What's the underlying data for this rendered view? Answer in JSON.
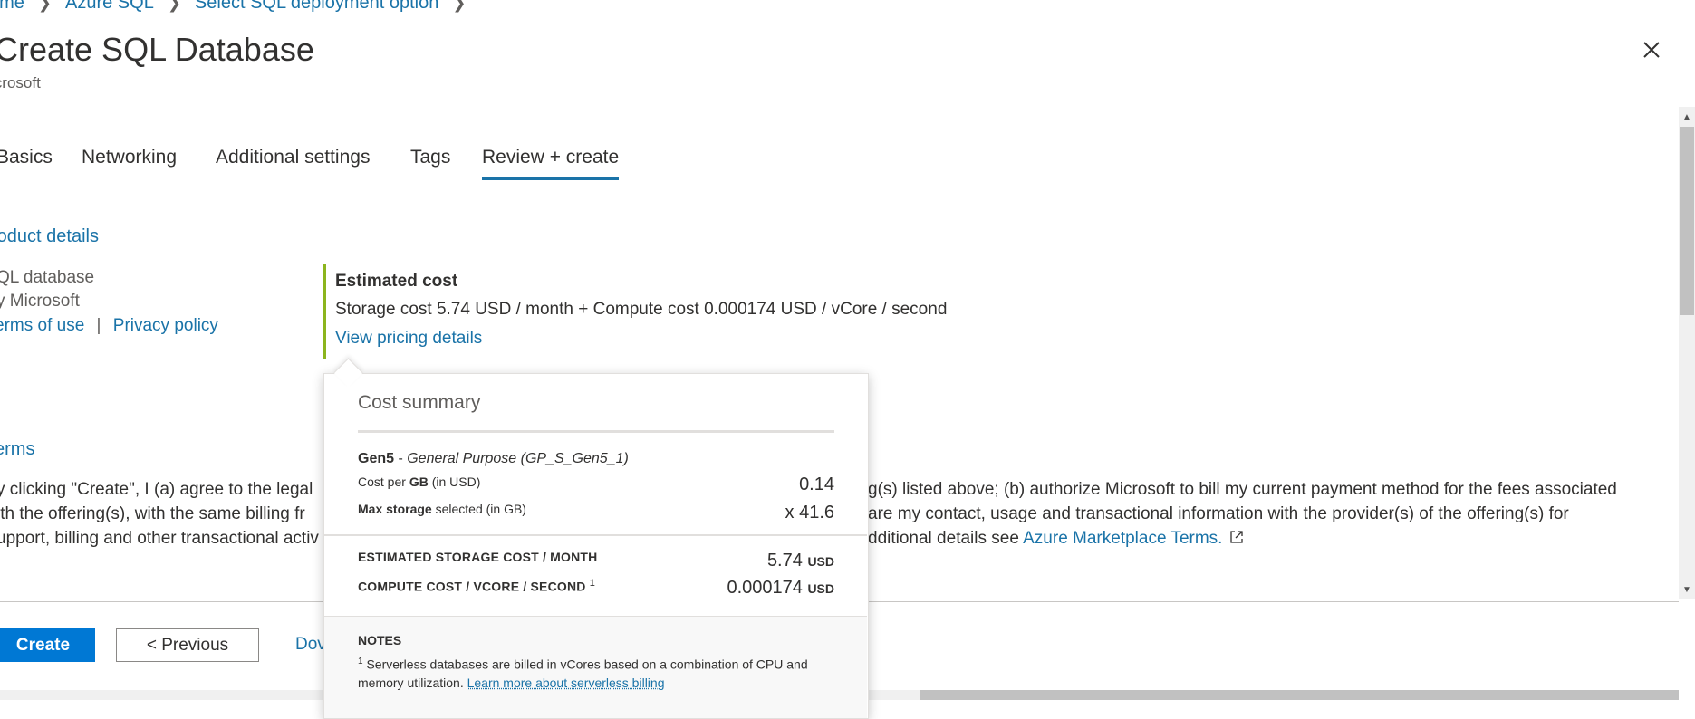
{
  "breadcrumb": {
    "items": [
      "ome",
      "Azure SQL",
      "Select SQL deployment option"
    ]
  },
  "header": {
    "title": "Create SQL Database",
    "publisher": "icrosoft"
  },
  "tabs": [
    {
      "label": "Basics"
    },
    {
      "label": "Networking"
    },
    {
      "label": "Additional settings"
    },
    {
      "label": "Tags"
    },
    {
      "label": "Review + create",
      "active": true
    }
  ],
  "product_details": {
    "heading": "roduct details",
    "name": "QL database",
    "by": "y Microsoft",
    "terms_link": "erms of use",
    "divider": "|",
    "privacy_link": "Privacy policy"
  },
  "estimated_cost": {
    "title": "Estimated cost",
    "line": "Storage cost 5.74 USD / month + Compute cost 0.000174 USD / vCore / second",
    "link": "View pricing details"
  },
  "terms": {
    "heading": "erms",
    "line1_left": "y clicking \"Create\", I (a) agree to the legal",
    "line1_right": "g(s) listed above; (b) authorize Microsoft to bill my current payment method for the fees associated",
    "line2_left": "ith the offering(s), with the same billing fr",
    "line2_right": "are my contact, usage and transactional information with the provider(s) of the offering(s) for",
    "line3_left": "upport, billing and other transactional activ",
    "line3_right": "dditional details see",
    "marketplace_link": "Azure Marketplace Terms."
  },
  "footer": {
    "create_label": "Create",
    "previous_label": "< Previous",
    "download_label": "Dov"
  },
  "cost_summary": {
    "title": "Cost summary",
    "tier_gen": "Gen5",
    "tier_dash": " - ",
    "tier_name": "General Purpose (GP_S_Gen5_1)",
    "cost_per_prefix": "Cost per ",
    "cost_per_unit": "GB",
    "cost_per_suffix": " (in USD)",
    "cost_per_value": "0.14",
    "max_storage_label": "Max storage",
    "max_storage_suffix": " selected (in GB)",
    "max_storage_value": "x 41.6",
    "storage_month_label": "ESTIMATED STORAGE COST / MONTH",
    "storage_month_value": "5.74",
    "compute_label": "COMPUTE COST / VCORE / SECOND",
    "compute_sup": "1",
    "compute_value": "0.000174",
    "currency": "USD",
    "notes_heading": "NOTES",
    "notes_sup": "1",
    "notes_text": " Serverless databases are billed in vCores based on a combination of CPU and memory utilization. ",
    "notes_link": "Learn more about serverless billing"
  },
  "colors": {
    "accent": "#0078d4",
    "link": "#1a73a8",
    "cost_bar": "#8cb51e"
  }
}
